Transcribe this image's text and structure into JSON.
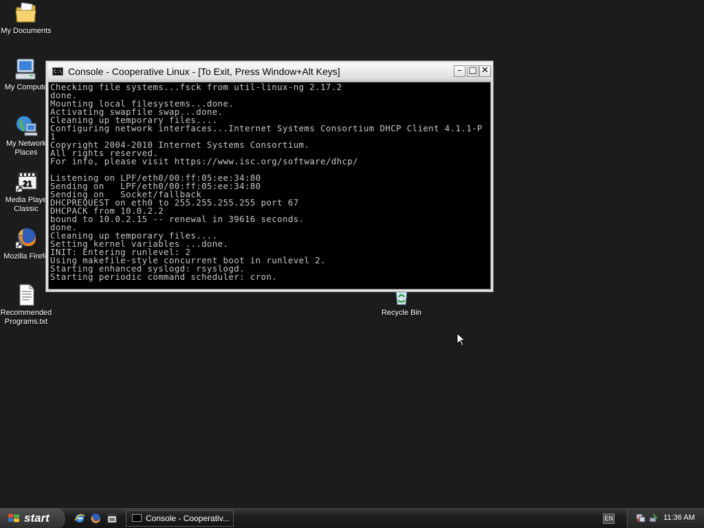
{
  "desktop": {
    "icons": [
      {
        "label": "My Documents",
        "icon": "my-documents-icon"
      },
      {
        "label": "My Compute",
        "icon": "my-computer-icon"
      },
      {
        "label": "My Network\nPlaces",
        "icon": "network-places-icon"
      },
      {
        "label": "Media Playe\nClassic",
        "icon": "media-player-classic-icon"
      },
      {
        "label": "Mozilla Firefo",
        "icon": "firefox-icon"
      },
      {
        "label": "Recommended\nPrograms.txt",
        "icon": "text-file-icon"
      },
      {
        "label": "Recycle Bin",
        "icon": "recycle-bin-icon"
      }
    ]
  },
  "window": {
    "title": "Console - Cooperative Linux - [To Exit, Press Window+Alt Keys]",
    "icon_text": "C:\\",
    "minimize": "–",
    "maximize": "□",
    "close": "✕",
    "lines": [
      "Checking file systems...fsck from util-linux-ng 2.17.2",
      "done.",
      "Mounting local filesystems...done.",
      "Activating swapfile swap...done.",
      "Cleaning up temporary files....",
      "Configuring network interfaces...Internet Systems Consortium DHCP Client 4.1.1-P",
      "1",
      "Copyright 2004-2010 Internet Systems Consortium.",
      "All rights reserved.",
      "For info, please visit https://www.isc.org/software/dhcp/",
      "",
      "Listening on LPF/eth0/00:ff:05:ee:34:80",
      "Sending on   LPF/eth0/00:ff:05:ee:34:80",
      "Sending on   Socket/fallback",
      "DHCPREQUEST on eth0 to 255.255.255.255 port 67",
      "DHCPACK from 10.0.2.2",
      "bound to 10.0.2.15 -- renewal in 39616 seconds.",
      "done.",
      "Cleaning up temporary files....",
      "Setting kernel variables ...done.",
      "INIT: Entering runlevel: 2",
      "Using makefile-style concurrent boot in runlevel 2.",
      "Starting enhanced syslogd: rsyslogd.",
      "Starting periodic command scheduler: cron."
    ]
  },
  "taskbar": {
    "start_label": "start",
    "quick_launch": [
      "internet-explorer-icon",
      "firefox-icon",
      "media-player-classic-icon"
    ],
    "task_label": "Console - Cooperativ...",
    "language": "EN",
    "tray_icons": [
      "network-icon",
      "safely-remove-hardware-icon"
    ],
    "clock": "11:36 AM"
  },
  "colors": {
    "desktop_bg": "#1c1c1c",
    "console_bg": "#000000",
    "console_fg": "#c8c8c8"
  }
}
